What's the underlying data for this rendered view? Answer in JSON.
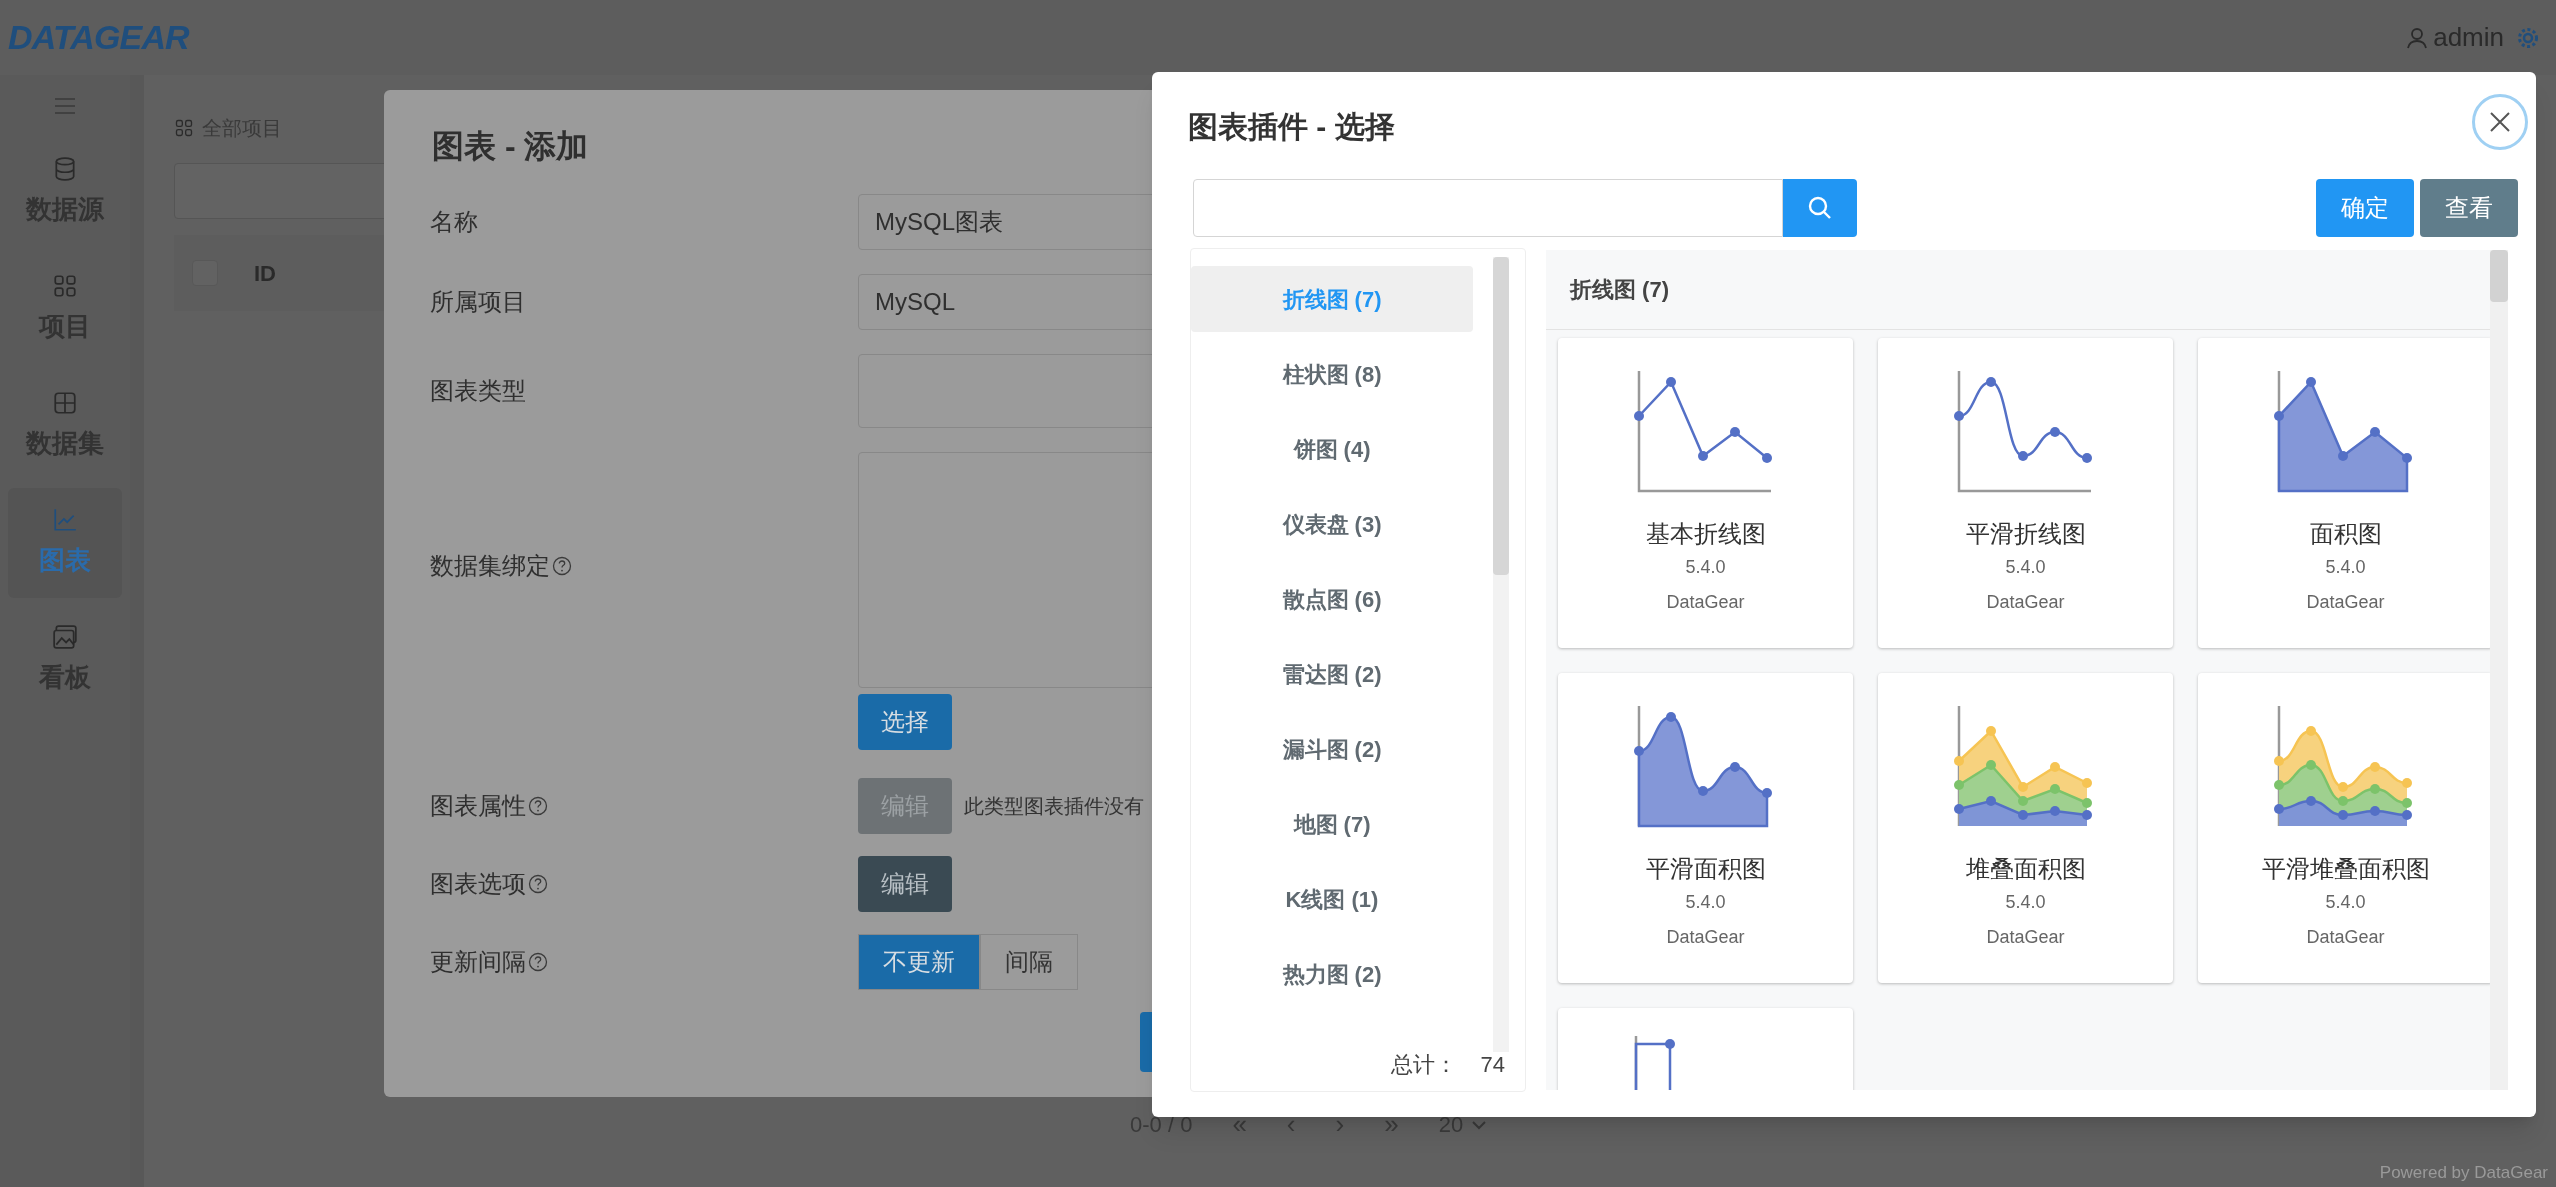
{
  "header": {
    "logo": "DATAGEAR",
    "user": "admin"
  },
  "sidebar": {
    "items": [
      {
        "label": "数据源",
        "selected": false
      },
      {
        "label": "项目",
        "selected": false
      },
      {
        "label": "数据集",
        "selected": false
      },
      {
        "label": "图表",
        "selected": true
      },
      {
        "label": "看板",
        "selected": false
      }
    ]
  },
  "background_page": {
    "breadcrumb": "全部项目",
    "table": {
      "all_checked": false,
      "columns": [
        "ID"
      ]
    },
    "pagination": {
      "range": "0-0 / 0",
      "first": "«",
      "prev": "‹",
      "next": "›",
      "last": "»",
      "page_size": "20"
    },
    "footer": "Powered by DataGear"
  },
  "chart_form": {
    "title": "图表 - 添加",
    "fields": [
      {
        "kind": "text",
        "label": "名称",
        "value": "MySQL图表",
        "help": false
      },
      {
        "kind": "text",
        "label": "所属项目",
        "value": "MySQL",
        "help": false
      },
      {
        "kind": "text",
        "label": "图表类型",
        "help": false
      },
      {
        "kind": "textarea",
        "label": "数据集绑定",
        "help": true,
        "button": "选择"
      },
      {
        "kind": "button",
        "label": "图表属性",
        "help": true,
        "button": "编辑",
        "disabled": true,
        "note": "此类型图表插件没有"
      },
      {
        "kind": "button",
        "label": "图表选项",
        "help": true,
        "button": "编辑",
        "disabled": false
      },
      {
        "kind": "toggle",
        "label": "更新间隔",
        "help": true,
        "options": [
          {
            "label": "不更新",
            "selected": true
          },
          {
            "label": "间隔",
            "selected": false
          }
        ]
      }
    ]
  },
  "plugin_dialog": {
    "title": "图表插件 - 选择",
    "buttons": [
      {
        "kind": "primary",
        "label": "确定"
      },
      {
        "kind": "secondary",
        "label": "查看"
      }
    ],
    "categories": [
      {
        "label": "折线图 (7)",
        "selected": true
      },
      {
        "label": "柱状图 (8)",
        "selected": false
      },
      {
        "label": "饼图 (4)",
        "selected": false
      },
      {
        "label": "仪表盘 (3)",
        "selected": false
      },
      {
        "label": "散点图 (6)",
        "selected": false
      },
      {
        "label": "雷达图 (2)",
        "selected": false
      },
      {
        "label": "漏斗图 (2)",
        "selected": false
      },
      {
        "label": "地图 (7)",
        "selected": false
      },
      {
        "label": "K线图 (1)",
        "selected": false
      },
      {
        "label": "热力图 (2)",
        "selected": false
      }
    ],
    "total_label": "总计：",
    "total": "74",
    "section": {
      "title": "折线图 (7)",
      "plugins": [
        {
          "kind": "line",
          "name": "基本折线图",
          "version": "5.4.0",
          "author": "DataGear"
        },
        {
          "kind": "smooth-line",
          "name": "平滑折线图",
          "version": "5.4.0",
          "author": "DataGear"
        },
        {
          "kind": "area",
          "name": "面积图",
          "version": "5.4.0",
          "author": "DataGear"
        },
        {
          "kind": "smooth-area",
          "name": "平滑面积图",
          "version": "5.4.0",
          "author": "DataGear"
        },
        {
          "kind": "stacked-area",
          "name": "堆叠面积图",
          "version": "5.4.0",
          "author": "DataGear"
        },
        {
          "kind": "smooth-stacked-area",
          "name": "平滑堆叠面积图",
          "version": "5.4.0",
          "author": "DataGear"
        },
        {
          "kind": "step-line"
        }
      ]
    }
  }
}
